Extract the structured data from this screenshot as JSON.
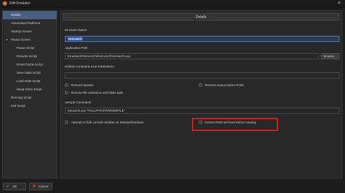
{
  "window": {
    "title": "Edit Emulator",
    "close_glyph": "✕"
  },
  "sidebar": {
    "items": [
      {
        "label": "Details",
        "active": true
      },
      {
        "label": "Associated Platforms"
      },
      {
        "label": "Startup Screen"
      },
      {
        "label": "Pause Screen",
        "expanded": true
      },
      {
        "label": "Pause Script"
      },
      {
        "label": "Resume Script"
      },
      {
        "label": "Reset Game Script"
      },
      {
        "label": "Save State Script"
      },
      {
        "label": "Load State Script"
      },
      {
        "label": "Swap Discs Script"
      },
      {
        "label": "Running Script"
      },
      {
        "label": "Exit Script"
      }
    ],
    "expand_glyph": "▾"
  },
  "content": {
    "header": "Details",
    "emulator_name": {
      "label": "Emulator Name:",
      "value": "Retroarch"
    },
    "app_path": {
      "label": "Application Path:",
      "value": "Emulators\\RetroArch\\RetroArch\\retroarch.exe",
      "browse_label": "Browse..."
    },
    "default_cmd": {
      "label": "Default Command-Line Parameters:",
      "value": ""
    },
    "checkboxes": {
      "remove_quotes": "Remove Quotes",
      "remove_space": "Remove space before ROM",
      "remove_ext": "Remove file extension and folder path",
      "hide_console": "Attempt to hide console window on startup/shutdown",
      "extract_rom": "Extract ROM archives before running"
    },
    "sample_cmd": {
      "label": "Sample Command:",
      "value": "retroarch.exe \"FULLPATH\\TO\\ROM\\FILE\""
    }
  },
  "footer": {
    "ok_label": "OK",
    "cancel_label": "Cancel",
    "ok_glyph": "✔",
    "cancel_glyph": "✖"
  },
  "colors": {
    "accent": "#4b5f82",
    "highlight": "#d21f1f"
  }
}
